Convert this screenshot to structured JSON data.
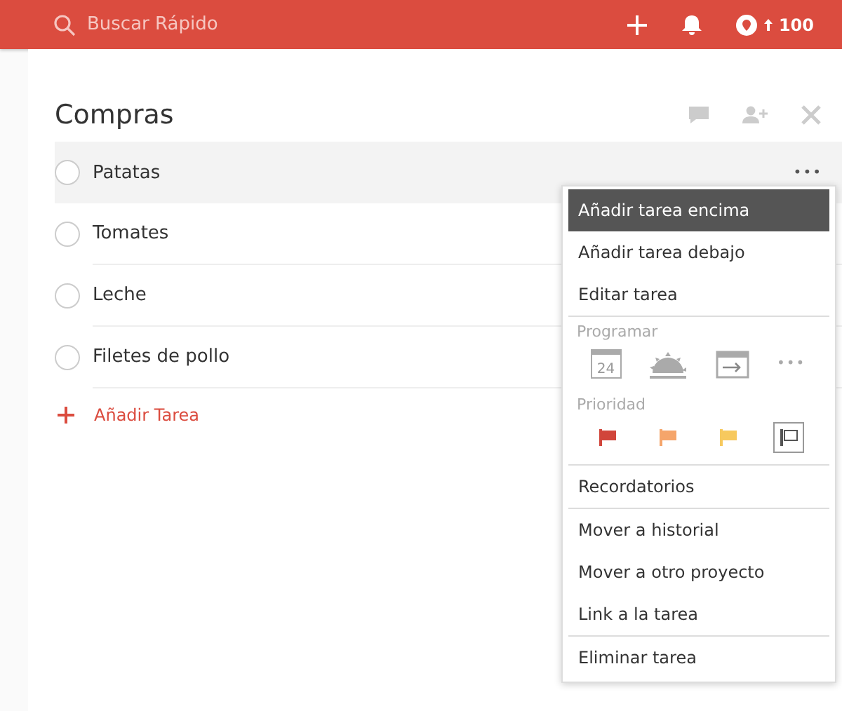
{
  "topbar": {
    "search": {
      "placeholder": "Buscar Rápido"
    },
    "karma": "100"
  },
  "project": {
    "title": "Compras"
  },
  "tasks": [
    {
      "label": "Patatas",
      "checked": false,
      "highlighted": true,
      "more": "•••"
    },
    {
      "label": "Tomates",
      "checked": false,
      "highlighted": false
    },
    {
      "label": "Leche",
      "checked": false,
      "highlighted": false
    },
    {
      "label": "Filetes de pollo",
      "checked": false,
      "highlighted": false
    }
  ],
  "add_task": "Añadir Tarea",
  "menu": [
    {
      "kind": "item",
      "label": "Añadir tarea encima",
      "selected": true
    },
    {
      "kind": "item",
      "label": "Añadir tarea debajo",
      "selected": false
    },
    {
      "kind": "item",
      "label": "Editar tarea",
      "selected": false
    },
    {
      "kind": "divider"
    },
    {
      "kind": "schedule",
      "title": "Programar",
      "today": "24",
      "more": "•••"
    },
    {
      "kind": "priority",
      "title": "Prioridad",
      "flags": [
        {
          "color": "#d1453b",
          "selected": false
        },
        {
          "color": "#f5a56b",
          "selected": false
        },
        {
          "color": "#f7c95e",
          "selected": false
        },
        {
          "color": "#555555",
          "selected": true
        }
      ]
    },
    {
      "kind": "divider"
    },
    {
      "kind": "item",
      "label": "Recordatorios",
      "selected": false
    },
    {
      "kind": "divider"
    },
    {
      "kind": "item",
      "label": "Mover a historial",
      "selected": false
    },
    {
      "kind": "item",
      "label": "Mover a otro proyecto",
      "selected": false
    },
    {
      "kind": "item",
      "label": "Link a la tarea",
      "selected": false
    },
    {
      "kind": "divider"
    },
    {
      "kind": "item",
      "label": "Eliminar tarea",
      "selected": false
    }
  ]
}
